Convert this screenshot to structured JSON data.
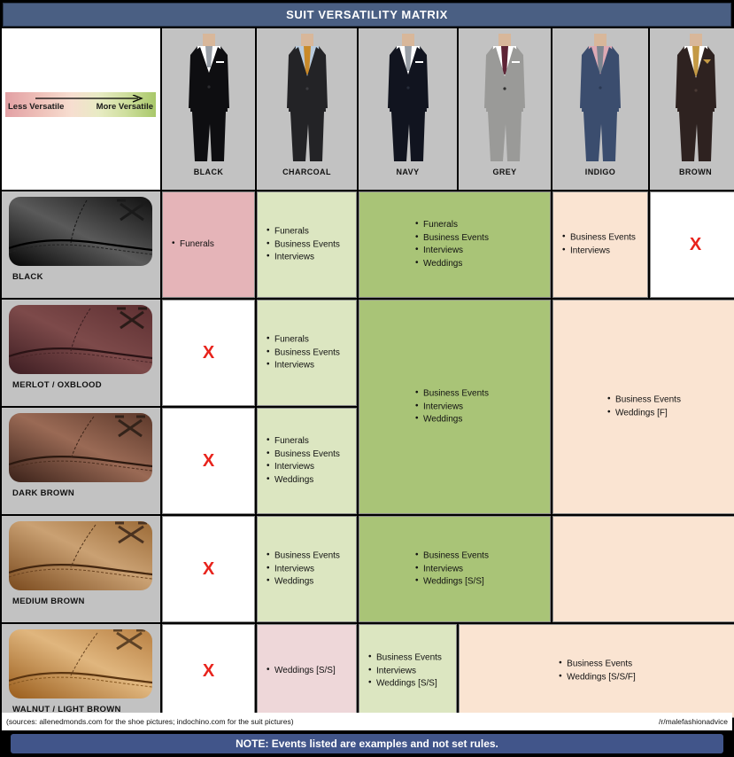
{
  "title": "SUIT VERSATILITY MATRIX",
  "legend": {
    "less_label": "Less Versatile",
    "more_label": "More Versatile",
    "arrow_icon": "arrow-right-icon",
    "gradient_from": "#e2a0a4",
    "gradient_to": "#a9c86a"
  },
  "columns": [
    {
      "label": "BLACK",
      "suit_color": "#0e0e11",
      "shirt_color": "#ffffff",
      "tie_color": "#9aa0a8"
    },
    {
      "label": "CHARCOAL",
      "suit_color": "#232326",
      "shirt_color": "#b9cbdd",
      "tie_color": "#c98a2a"
    },
    {
      "label": "NAVY",
      "suit_color": "#11141f",
      "shirt_color": "#ffffff",
      "tie_color": "#9aa0a8"
    },
    {
      "label": "GREY",
      "suit_color": "#9a9a98",
      "shirt_color": "#ffffff",
      "tie_color": "#5e2436"
    },
    {
      "label": "INDIGO",
      "suit_color": "#3b4d6e",
      "shirt_color": "#dda9b4",
      "tie_color": "#7d8590"
    },
    {
      "label": "BROWN",
      "suit_color": "#2e2220",
      "shirt_color": "#ffffff",
      "tie_color": "#c49a45"
    }
  ],
  "rows": [
    {
      "label": "BLACK",
      "shoe_from": "#050505",
      "shoe_mid": "#5a5a5a",
      "shoe_to": "#101010"
    },
    {
      "label": "MERLOT / OXBLOOD",
      "shoe_from": "#3d1d22",
      "shoe_mid": "#7d4a4a",
      "shoe_to": "#5d2f31"
    },
    {
      "label": "DARK BROWN",
      "shoe_from": "#3a2119",
      "shoe_mid": "#9a6a55",
      "shoe_to": "#5c382a"
    },
    {
      "label": "MEDIUM BROWN",
      "shoe_from": "#7a4a1e",
      "shoe_mid": "#caa173",
      "shoe_to": "#9b6a36"
    },
    {
      "label": "WALNUT / LIGHT BROWN",
      "shoe_from": "#9a5d1c",
      "shoe_mid": "#e0b67e",
      "shoe_to": "#b88043"
    }
  ],
  "x_mark": "X",
  "cells": {
    "black_black": {
      "items": [
        "Funerals"
      ]
    },
    "black_charcoal": {
      "items": [
        "Funerals",
        "Business Events",
        "Interviews"
      ]
    },
    "black_navygrey": {
      "items": [
        "Funerals",
        "Business Events",
        "Interviews",
        "Weddings"
      ]
    },
    "black_indigo": {
      "items": [
        "Business Events",
        "Interviews"
      ]
    },
    "merlot_charcoal": {
      "items": [
        "Funerals",
        "Business Events",
        "Interviews"
      ]
    },
    "merlot_navygrey": {
      "items": [
        "Business Events",
        "Interviews",
        "Weddings"
      ]
    },
    "darkbrown_charcoal": {
      "items": [
        "Funerals",
        "Business Events",
        "Interviews",
        "Weddings"
      ]
    },
    "brown_indigobrown": {
      "items": [
        "Business Events",
        "Weddings [F]"
      ]
    },
    "medium_charcoal": {
      "items": [
        "Business Events",
        "Interviews",
        "Weddings"
      ]
    },
    "medium_navygrey": {
      "items": [
        "Business Events",
        "Interviews",
        "Weddings [S/S]"
      ]
    },
    "walnut_charcoal": {
      "items": [
        "Weddings [S/S]"
      ]
    },
    "walnut_navy": {
      "items": [
        "Business Events",
        "Interviews",
        "Weddings [S/S]"
      ]
    },
    "walnut_greyindigobrown": {
      "items": [
        "Business Events",
        "Weddings [S/S/F]"
      ]
    }
  },
  "footer": {
    "sources": "(sources: allenedmonds.com for the shoe pictures; indochino.com for the suit pictures)",
    "credit": "/r/malefashionadvice",
    "note": "NOTE:  Events listed are examples and not set rules."
  }
}
